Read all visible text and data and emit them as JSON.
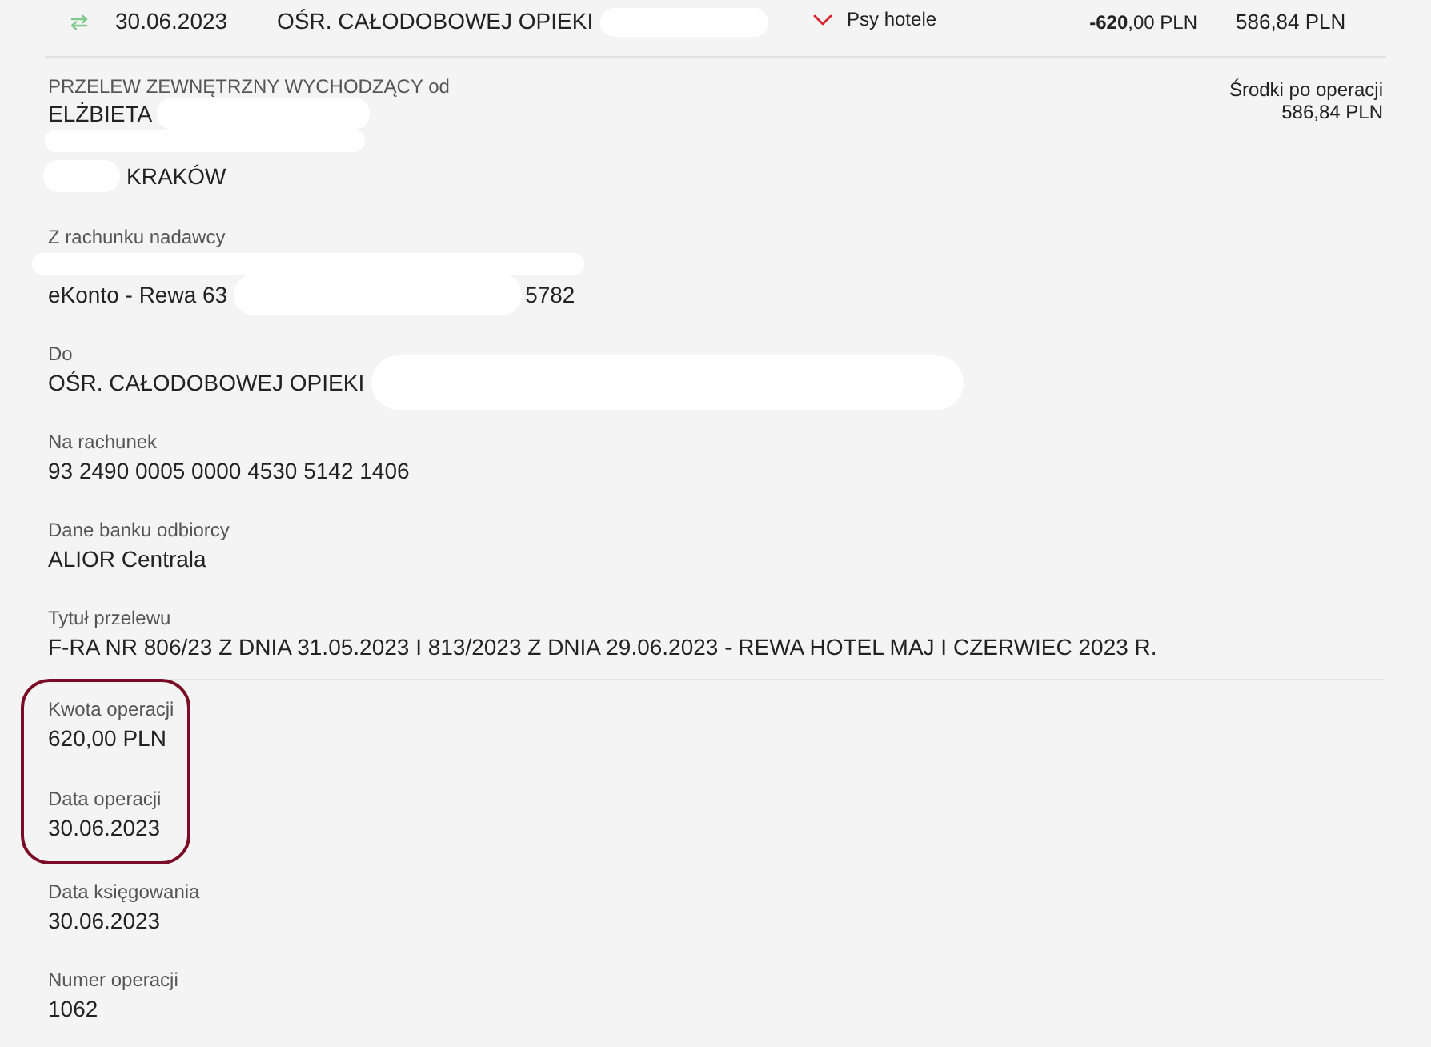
{
  "transaction_row": {
    "date": "30.06.2023",
    "payee": [
      {
        "kind": "text",
        "text": "OŚR. CAŁODOBOWEJ OPIEKI"
      },
      {
        "kind": "redaction"
      }
    ],
    "category": "Psy hotele",
    "amount": "**-620**,00 PLN",
    "balance": "586,84 PLN"
  },
  "header": {
    "label": "PRZELEW ZEWNĘTRZNY WYCHODZĄCY od",
    "lines": [
      [
        {
          "kind": "text",
          "text": "ELŻBIETA"
        },
        {
          "kind": "redaction"
        }
      ],
      [
        {
          "kind": "redaction"
        }
      ],
      [
        {
          "kind": "redaction"
        },
        {
          "kind": "text",
          "text": "KRAKÓW"
        }
      ]
    ]
  },
  "balance_after": {
    "label": "Środki po operacji",
    "value": "586,84 PLN"
  },
  "sections": [
    {
      "fields": [
        {
          "label": "Z rachunku nadawcy",
          "highlighted": false,
          "lines": [
            [
              {
                "kind": "redaction"
              }
            ],
            [
              {
                "kind": "text",
                "text": "eKonto - Rewa 63"
              },
              {
                "kind": "redaction"
              },
              {
                "kind": "text",
                "text": "5782"
              }
            ]
          ]
        },
        {
          "label": "Do",
          "highlighted": false,
          "lines": [
            [
              {
                "kind": "text",
                "text": "OŚR. CAŁODOBOWEJ OPIEKI"
              },
              {
                "kind": "redaction"
              }
            ]
          ]
        },
        {
          "label": "Na rachunek",
          "highlighted": false,
          "lines": [
            [
              {
                "kind": "text",
                "text": "93 2490 0005 0000 4530 5142 1406"
              }
            ]
          ]
        },
        {
          "label": "Dane banku odbiorcy",
          "highlighted": false,
          "lines": [
            [
              {
                "kind": "text",
                "text": "ALIOR Centrala"
              }
            ]
          ]
        },
        {
          "label": "Tytuł przelewu",
          "highlighted": false,
          "lines": [
            [
              {
                "kind": "text",
                "text": "F-RA NR 806/23 Z DNIA 31.05.2023 I 813/2023 Z DNIA 29.06.2023 - REWA HOTEL MAJ I CZERWIEC 2023 R."
              }
            ]
          ]
        }
      ]
    },
    {
      "fields": [
        {
          "label": "Kwota operacji",
          "highlighted": true,
          "lines": [
            [
              {
                "kind": "text",
                "text": "620,00 PLN"
              }
            ]
          ]
        },
        {
          "label": "Data operacji",
          "highlighted": true,
          "lines": [
            [
              {
                "kind": "text",
                "text": "30.06.2023"
              }
            ]
          ]
        },
        {
          "label": "Data księgowania",
          "highlighted": false,
          "lines": [
            [
              {
                "kind": "text",
                "text": "30.06.2023"
              }
            ]
          ]
        },
        {
          "label": "Numer operacji",
          "highlighted": false,
          "lines": [
            [
              {
                "kind": "text",
                "text": "1062"
              }
            ]
          ]
        }
      ]
    }
  ]
}
